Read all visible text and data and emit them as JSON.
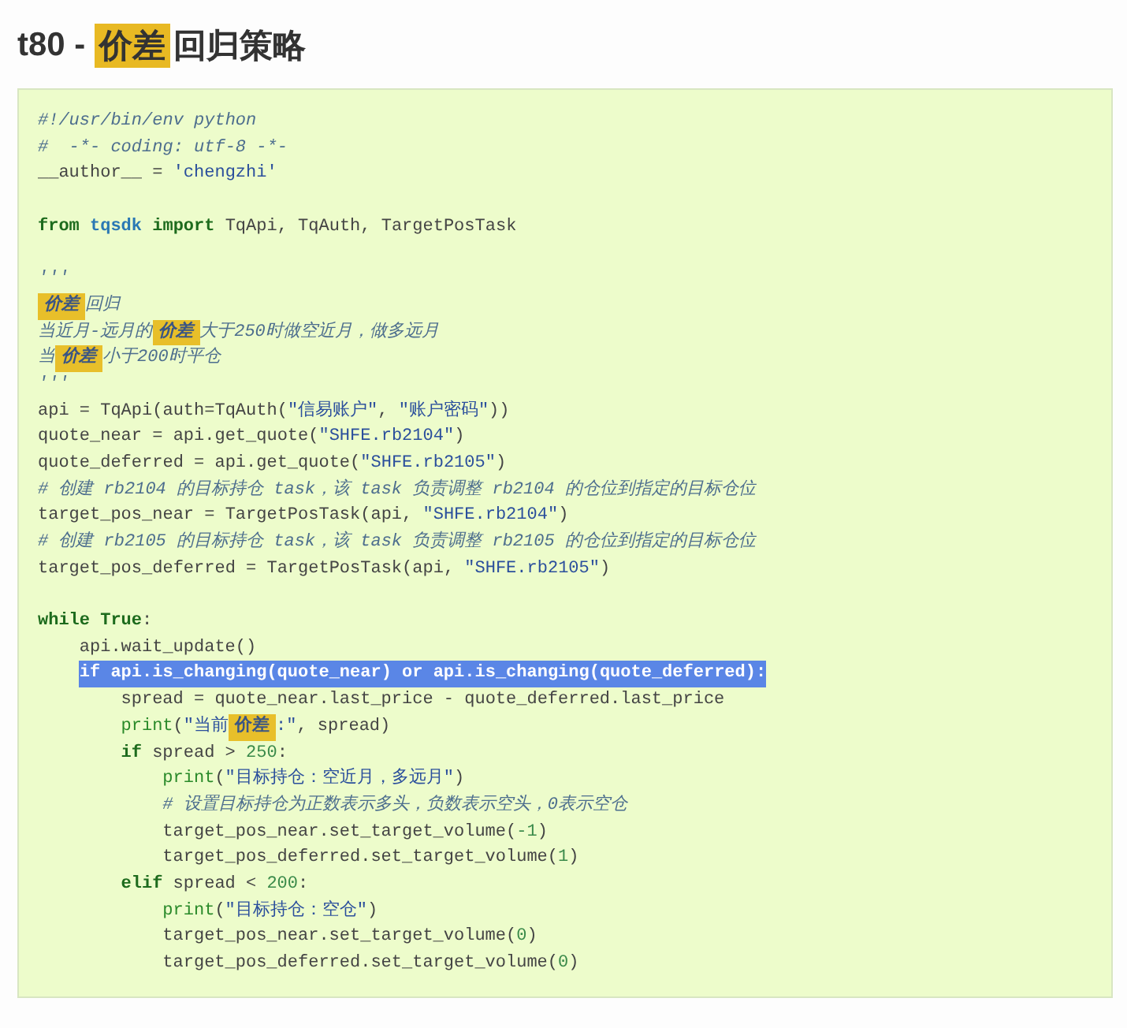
{
  "title": [
    {
      "kind": "plain",
      "text": "t80 - "
    },
    {
      "kind": "mark",
      "text": "价差"
    },
    {
      "kind": "plain",
      "text": "回归策略"
    }
  ],
  "code": [
    {
      "kind": "code",
      "selected": false,
      "tokens": [
        {
          "kind": "comment",
          "text": "#!/usr/bin/env python"
        }
      ]
    },
    {
      "kind": "code",
      "selected": false,
      "tokens": [
        {
          "kind": "comment",
          "text": "#  -*- coding: utf-8 -*-"
        }
      ]
    },
    {
      "kind": "code",
      "selected": false,
      "tokens": [
        {
          "kind": "plain",
          "text": "__author__ = "
        },
        {
          "kind": "string",
          "text": "'chengzhi'"
        }
      ]
    },
    {
      "kind": "blank"
    },
    {
      "kind": "code",
      "selected": false,
      "tokens": [
        {
          "kind": "keyword",
          "text": "from"
        },
        {
          "kind": "module",
          "text": " tqsdk"
        },
        {
          "kind": "keyword",
          "text": " import"
        },
        {
          "kind": "plain",
          "text": " TqApi, TqAuth, TargetPosTask"
        }
      ]
    },
    {
      "kind": "blank"
    },
    {
      "kind": "code",
      "selected": false,
      "tokens": [
        {
          "kind": "comment",
          "text": "'''"
        }
      ]
    },
    {
      "kind": "code",
      "selected": false,
      "tokens": [
        {
          "kind": "mark",
          "text": "价差"
        },
        {
          "kind": "comment",
          "text": "回归"
        }
      ]
    },
    {
      "kind": "code",
      "selected": false,
      "tokens": [
        {
          "kind": "comment",
          "text": "当近月-远月的"
        },
        {
          "kind": "mark",
          "text": "价差"
        },
        {
          "kind": "comment",
          "text": "大于250时做空近月，做多远月"
        }
      ]
    },
    {
      "kind": "code",
      "selected": false,
      "tokens": [
        {
          "kind": "comment",
          "text": "当"
        },
        {
          "kind": "mark",
          "text": "价差"
        },
        {
          "kind": "comment",
          "text": "小于200时平仓"
        }
      ]
    },
    {
      "kind": "code",
      "selected": false,
      "tokens": [
        {
          "kind": "comment",
          "text": "'''"
        }
      ]
    },
    {
      "kind": "code",
      "selected": false,
      "tokens": [
        {
          "kind": "plain",
          "text": "api = TqApi(auth=TqAuth("
        },
        {
          "kind": "string",
          "text": "\"信易账户\""
        },
        {
          "kind": "plain",
          "text": ", "
        },
        {
          "kind": "string",
          "text": "\"账户密码\""
        },
        {
          "kind": "plain",
          "text": "))"
        }
      ]
    },
    {
      "kind": "code",
      "selected": false,
      "tokens": [
        {
          "kind": "plain",
          "text": "quote_near = api.get_quote("
        },
        {
          "kind": "string",
          "text": "\"SHFE.rb2104\""
        },
        {
          "kind": "plain",
          "text": ")"
        }
      ]
    },
    {
      "kind": "code",
      "selected": false,
      "tokens": [
        {
          "kind": "plain",
          "text": "quote_deferred = api.get_quote("
        },
        {
          "kind": "string",
          "text": "\"SHFE.rb2105\""
        },
        {
          "kind": "plain",
          "text": ")"
        }
      ]
    },
    {
      "kind": "code",
      "selected": false,
      "tokens": [
        {
          "kind": "comment",
          "text": "# 创建 rb2104 的目标持仓 task，该 task 负责调整 rb2104 的仓位到指定的目标仓位"
        }
      ]
    },
    {
      "kind": "code",
      "selected": false,
      "tokens": [
        {
          "kind": "plain",
          "text": "target_pos_near = TargetPosTask(api, "
        },
        {
          "kind": "string",
          "text": "\"SHFE.rb2104\""
        },
        {
          "kind": "plain",
          "text": ")"
        }
      ]
    },
    {
      "kind": "code",
      "selected": false,
      "tokens": [
        {
          "kind": "comment",
          "text": "# 创建 rb2105 的目标持仓 task，该 task 负责调整 rb2105 的仓位到指定的目标仓位"
        }
      ]
    },
    {
      "kind": "code",
      "selected": false,
      "tokens": [
        {
          "kind": "plain",
          "text": "target_pos_deferred = TargetPosTask(api, "
        },
        {
          "kind": "string",
          "text": "\"SHFE.rb2105\""
        },
        {
          "kind": "plain",
          "text": ")"
        }
      ]
    },
    {
      "kind": "blank"
    },
    {
      "kind": "code",
      "selected": false,
      "tokens": [
        {
          "kind": "keyword",
          "text": "while True"
        },
        {
          "kind": "plain",
          "text": ":"
        }
      ],
      "children": [
        {
          "kind": "code",
          "selected": false,
          "tokens": [
            {
              "kind": "plain",
              "text": "api.wait_update()"
            }
          ]
        },
        {
          "kind": "code",
          "selected": true,
          "tokens": [
            {
              "kind": "keyword",
              "text": "if"
            },
            {
              "kind": "plain",
              "text": " api.is_changing(quote_near) "
            },
            {
              "kind": "keyword",
              "text": "or"
            },
            {
              "kind": "plain",
              "text": " api.is_changing(quote_deferred):"
            }
          ],
          "children": [
            {
              "kind": "code",
              "selected": false,
              "tokens": [
                {
                  "kind": "plain",
                  "text": "spread = quote_near.last_price - quote_deferred.last_price"
                }
              ]
            },
            {
              "kind": "code",
              "selected": false,
              "tokens": [
                {
                  "kind": "builtin",
                  "text": "print"
                },
                {
                  "kind": "plain",
                  "text": "("
                },
                {
                  "kind": "string",
                  "text": "\"当前"
                },
                {
                  "kind": "mark",
                  "text": "价差"
                },
                {
                  "kind": "string",
                  "text": ":\""
                },
                {
                  "kind": "plain",
                  "text": ", spread)"
                }
              ]
            },
            {
              "kind": "code",
              "selected": false,
              "tokens": [
                {
                  "kind": "keyword",
                  "text": "if"
                },
                {
                  "kind": "plain",
                  "text": " spread > "
                },
                {
                  "kind": "number",
                  "text": "250"
                },
                {
                  "kind": "plain",
                  "text": ":"
                }
              ],
              "children": [
                {
                  "kind": "code",
                  "selected": false,
                  "tokens": [
                    {
                      "kind": "builtin",
                      "text": "print"
                    },
                    {
                      "kind": "plain",
                      "text": "("
                    },
                    {
                      "kind": "string",
                      "text": "\"目标持仓：空近月，多远月\""
                    },
                    {
                      "kind": "plain",
                      "text": ")"
                    }
                  ]
                },
                {
                  "kind": "code",
                  "selected": false,
                  "tokens": [
                    {
                      "kind": "comment",
                      "text": "# 设置目标持仓为正数表示多头，负数表示空头，0表示空仓"
                    }
                  ]
                },
                {
                  "kind": "code",
                  "selected": false,
                  "tokens": [
                    {
                      "kind": "plain",
                      "text": "target_pos_near.set_target_volume("
                    },
                    {
                      "kind": "number",
                      "text": "-1"
                    },
                    {
                      "kind": "plain",
                      "text": ")"
                    }
                  ]
                },
                {
                  "kind": "code",
                  "selected": false,
                  "tokens": [
                    {
                      "kind": "plain",
                      "text": "target_pos_deferred.set_target_volume("
                    },
                    {
                      "kind": "number",
                      "text": "1"
                    },
                    {
                      "kind": "plain",
                      "text": ")"
                    }
                  ]
                }
              ]
            },
            {
              "kind": "code",
              "selected": false,
              "tokens": [
                {
                  "kind": "keyword",
                  "text": "elif"
                },
                {
                  "kind": "plain",
                  "text": " spread < "
                },
                {
                  "kind": "number",
                  "text": "200"
                },
                {
                  "kind": "plain",
                  "text": ":"
                }
              ],
              "children": [
                {
                  "kind": "code",
                  "selected": false,
                  "tokens": [
                    {
                      "kind": "builtin",
                      "text": "print"
                    },
                    {
                      "kind": "plain",
                      "text": "("
                    },
                    {
                      "kind": "string",
                      "text": "\"目标持仓：空仓\""
                    },
                    {
                      "kind": "plain",
                      "text": ")"
                    }
                  ]
                },
                {
                  "kind": "code",
                  "selected": false,
                  "tokens": [
                    {
                      "kind": "plain",
                      "text": "target_pos_near.set_target_volume("
                    },
                    {
                      "kind": "number",
                      "text": "0"
                    },
                    {
                      "kind": "plain",
                      "text": ")"
                    }
                  ]
                },
                {
                  "kind": "code",
                  "selected": false,
                  "tokens": [
                    {
                      "kind": "plain",
                      "text": "target_pos_deferred.set_target_volume("
                    },
                    {
                      "kind": "number",
                      "text": "0"
                    },
                    {
                      "kind": "plain",
                      "text": ")"
                    }
                  ]
                }
              ]
            }
          ]
        }
      ]
    }
  ]
}
